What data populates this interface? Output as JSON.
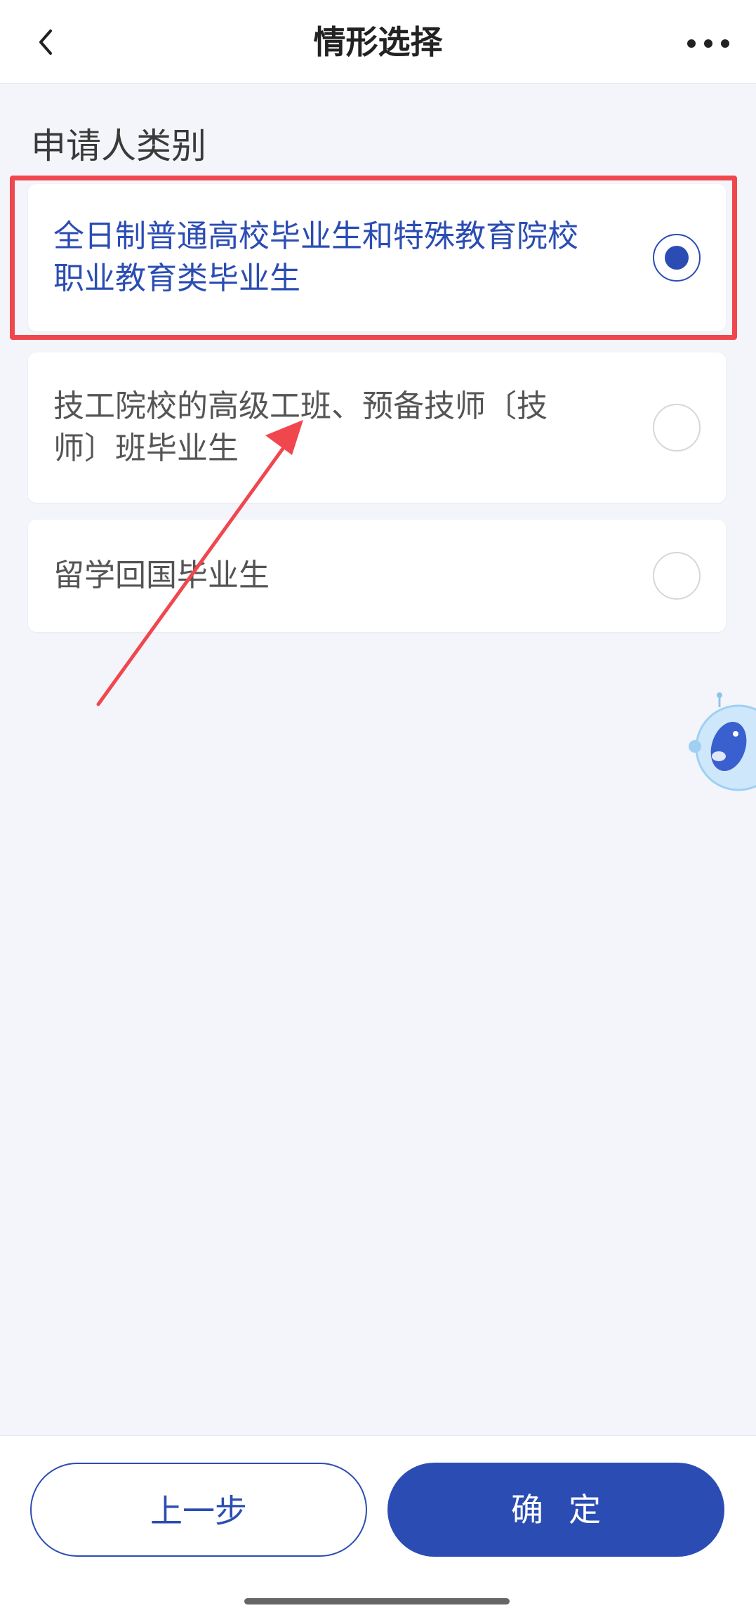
{
  "navbar": {
    "title": "情形选择",
    "back_icon": "chevron-left-icon",
    "more_icon": "more-horizontal-icon"
  },
  "section": {
    "label": "申请人类别"
  },
  "options": [
    {
      "line1": "全日制普通高校毕业生和特殊教育院校",
      "line2": "职业教育类毕业生",
      "selected": true
    },
    {
      "line1": "技工院校的高级工班、预备技师〔技",
      "line2": "师〕班毕业生",
      "selected": false
    },
    {
      "line1": "留学回国毕业生",
      "line2": "",
      "selected": false
    }
  ],
  "footer": {
    "prev_label": "上一步",
    "confirm_label": "确定"
  },
  "colors": {
    "accent": "#2b4db3",
    "annotation": "#f0474f",
    "background": "#f4f5fa"
  }
}
